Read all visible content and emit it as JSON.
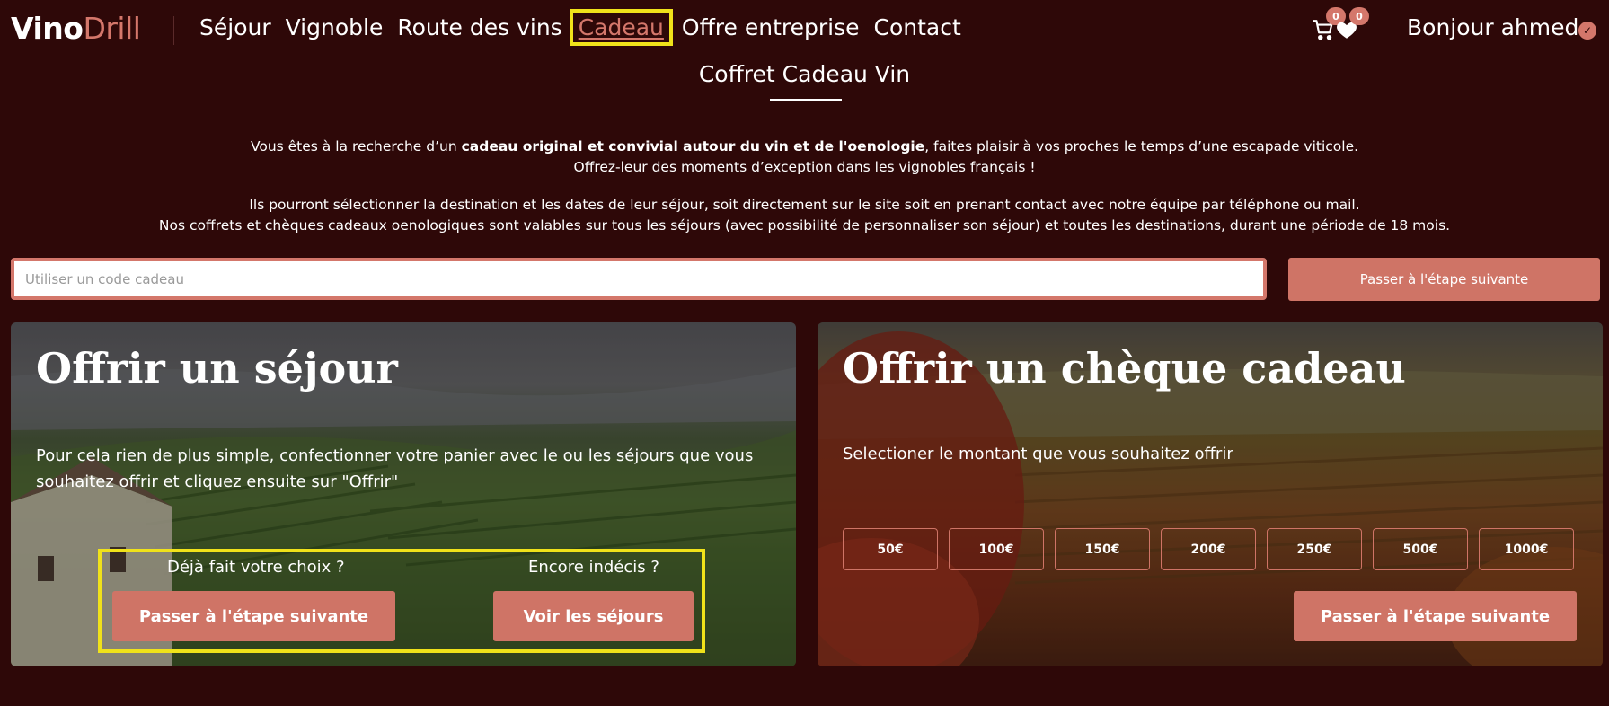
{
  "header": {
    "logo_part1": "Vino",
    "logo_part2": "Drill",
    "nav": [
      {
        "label": "Séjour"
      },
      {
        "label": "Vignoble"
      },
      {
        "label": "Route des vins"
      },
      {
        "label": "Cadeau",
        "active": true
      },
      {
        "label": "Offre entreprise"
      },
      {
        "label": "Contact"
      }
    ],
    "cart_count": "0",
    "wishlist_count": "0",
    "greeting": "Bonjour ahmed",
    "verified_icon": "✓",
    "accent_color": "#d4776b",
    "highlight_color": "#f0e21a"
  },
  "page": {
    "title": "Coffret Cadeau Vin",
    "intro_line1_a": "Vous êtes à la recherche d’un ",
    "intro_line1_b": "cadeau original et convivial autour du vin et de l'oenologie",
    "intro_line1_c": ", faites plaisir à vos proches le temps d’une escapade viticole.",
    "intro_line2": "Offrez-leur des moments d’exception dans les vignobles français !",
    "intro_line3": "Ils pourront sélectionner la destination et les dates de leur séjour, soit directement sur le site soit en prenant contact avec notre équipe par téléphone ou mail.",
    "intro_line4": "Nos coffrets et chèques cadeaux oenologiques sont valables sur tous les séjours (avec possibilité de personnaliser son séjour) et toutes les destinations, durant une période de 18 mois."
  },
  "gift_code": {
    "placeholder": "Utiliser un code cadeau",
    "button": "Passer à l'étape suivante"
  },
  "card_stay": {
    "title": "Offrir un séjour",
    "description": "Pour cela rien de plus simple, confectionner votre panier avec le ou les séjours que vous souhaitez offrir et cliquez ensuite sur \"Offrir\"",
    "q1": "Déjà fait votre choix ?",
    "btn1": "Passer à l'étape suivante",
    "q2": "Encore indécis ?",
    "btn2": "Voir les séjours"
  },
  "card_cheque": {
    "title": "Offrir un chèque cadeau",
    "description": "Selectioner le montant que vous souhaitez offrir",
    "amounts": [
      "50€",
      "100€",
      "150€",
      "200€",
      "250€",
      "500€",
      "1000€"
    ],
    "button": "Passer à l'étape suivante"
  }
}
